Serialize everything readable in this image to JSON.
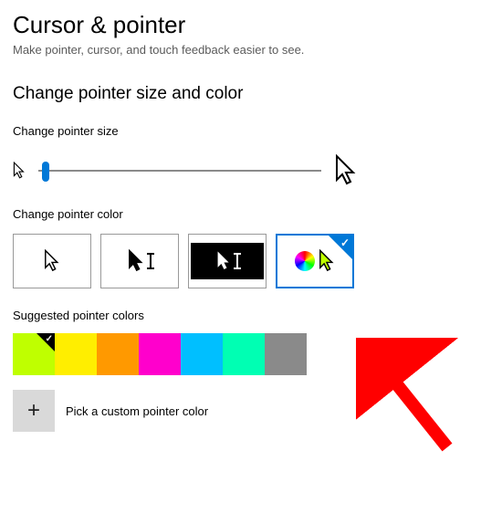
{
  "title": "Cursor & pointer",
  "subtitle": "Make pointer, cursor, and touch feedback easier to see.",
  "section_size_color": "Change pointer size and color",
  "label_size": "Change pointer size",
  "label_color": "Change pointer color",
  "label_suggested": "Suggested pointer colors",
  "custom_label": "Pick a custom pointer color",
  "slider": {
    "value": 1,
    "min": 1,
    "max": 15
  },
  "color_modes": {
    "white": {
      "selected": false
    },
    "black": {
      "selected": false
    },
    "inverted": {
      "selected": false
    },
    "custom": {
      "selected": true
    }
  },
  "suggested_colors": [
    {
      "hex": "#bfff00",
      "selected": true
    },
    {
      "hex": "#ffee00",
      "selected": false
    },
    {
      "hex": "#ff9900",
      "selected": false
    },
    {
      "hex": "#ff00cc",
      "selected": false
    },
    {
      "hex": "#00bfff",
      "selected": false
    },
    {
      "hex": "#00ffb3",
      "selected": false
    },
    {
      "hex": "#8a8a8a",
      "selected": false
    }
  ]
}
